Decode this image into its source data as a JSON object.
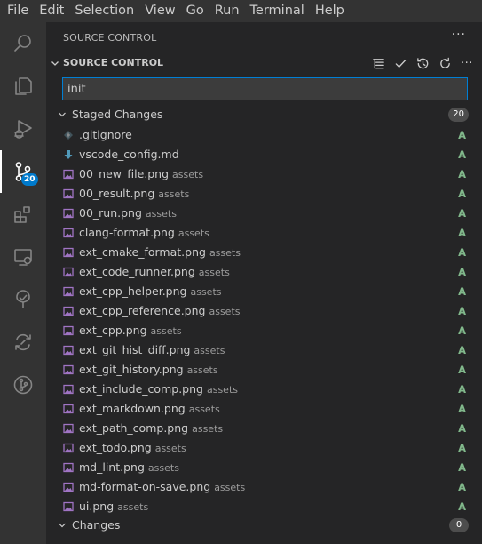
{
  "menu": [
    "File",
    "Edit",
    "Selection",
    "View",
    "Go",
    "Run",
    "Terminal",
    "Help"
  ],
  "activity_bar": {
    "items": [
      "explorer-icon",
      "search-icon",
      "run-debug-icon",
      "source-control-icon",
      "extensions-icon",
      "remote-explorer-icon",
      "testing-icon",
      "live-share-icon",
      "git-graph-icon"
    ],
    "scm_badge": "20"
  },
  "sidebar": {
    "title": "SOURCE CONTROL",
    "more": "···"
  },
  "section": {
    "title": "SOURCE CONTROL",
    "toolbar": [
      "view-as-tree-icon",
      "commit-check-icon",
      "history-icon",
      "refresh-icon",
      "more-actions-icon"
    ],
    "more": "···"
  },
  "commit_input": {
    "value": "init"
  },
  "staged": {
    "label": "Staged Changes",
    "count": "20",
    "files": [
      {
        "name": ".gitignore",
        "dir": "",
        "status": "A",
        "icon": "gitignore-icon"
      },
      {
        "name": "vscode_config.md",
        "dir": "",
        "status": "A",
        "icon": "markdown-download-icon"
      },
      {
        "name": "00_new_file.png",
        "dir": "assets",
        "status": "A",
        "icon": "image-icon"
      },
      {
        "name": "00_result.png",
        "dir": "assets",
        "status": "A",
        "icon": "image-icon"
      },
      {
        "name": "00_run.png",
        "dir": "assets",
        "status": "A",
        "icon": "image-icon"
      },
      {
        "name": "clang-format.png",
        "dir": "assets",
        "status": "A",
        "icon": "image-icon"
      },
      {
        "name": "ext_cmake_format.png",
        "dir": "assets",
        "status": "A",
        "icon": "image-icon"
      },
      {
        "name": "ext_code_runner.png",
        "dir": "assets",
        "status": "A",
        "icon": "image-icon"
      },
      {
        "name": "ext_cpp_helper.png",
        "dir": "assets",
        "status": "A",
        "icon": "image-icon"
      },
      {
        "name": "ext_cpp_reference.png",
        "dir": "assets",
        "status": "A",
        "icon": "image-icon"
      },
      {
        "name": "ext_cpp.png",
        "dir": "assets",
        "status": "A",
        "icon": "image-icon"
      },
      {
        "name": "ext_git_hist_diff.png",
        "dir": "assets",
        "status": "A",
        "icon": "image-icon"
      },
      {
        "name": "ext_git_history.png",
        "dir": "assets",
        "status": "A",
        "icon": "image-icon"
      },
      {
        "name": "ext_include_comp.png",
        "dir": "assets",
        "status": "A",
        "icon": "image-icon"
      },
      {
        "name": "ext_markdown.png",
        "dir": "assets",
        "status": "A",
        "icon": "image-icon"
      },
      {
        "name": "ext_path_comp.png",
        "dir": "assets",
        "status": "A",
        "icon": "image-icon"
      },
      {
        "name": "ext_todo.png",
        "dir": "assets",
        "status": "A",
        "icon": "image-icon"
      },
      {
        "name": "md_lint.png",
        "dir": "assets",
        "status": "A",
        "icon": "image-icon"
      },
      {
        "name": "md-format-on-save.png",
        "dir": "assets",
        "status": "A",
        "icon": "image-icon"
      },
      {
        "name": "ui.png",
        "dir": "assets",
        "status": "A",
        "icon": "image-icon"
      }
    ]
  },
  "changes": {
    "label": "Changes",
    "count": "0"
  },
  "colors": {
    "accent": "#007acc",
    "added": "#81b88b",
    "image_icon": "#a074c4",
    "markdown_icon": "#519aba"
  }
}
